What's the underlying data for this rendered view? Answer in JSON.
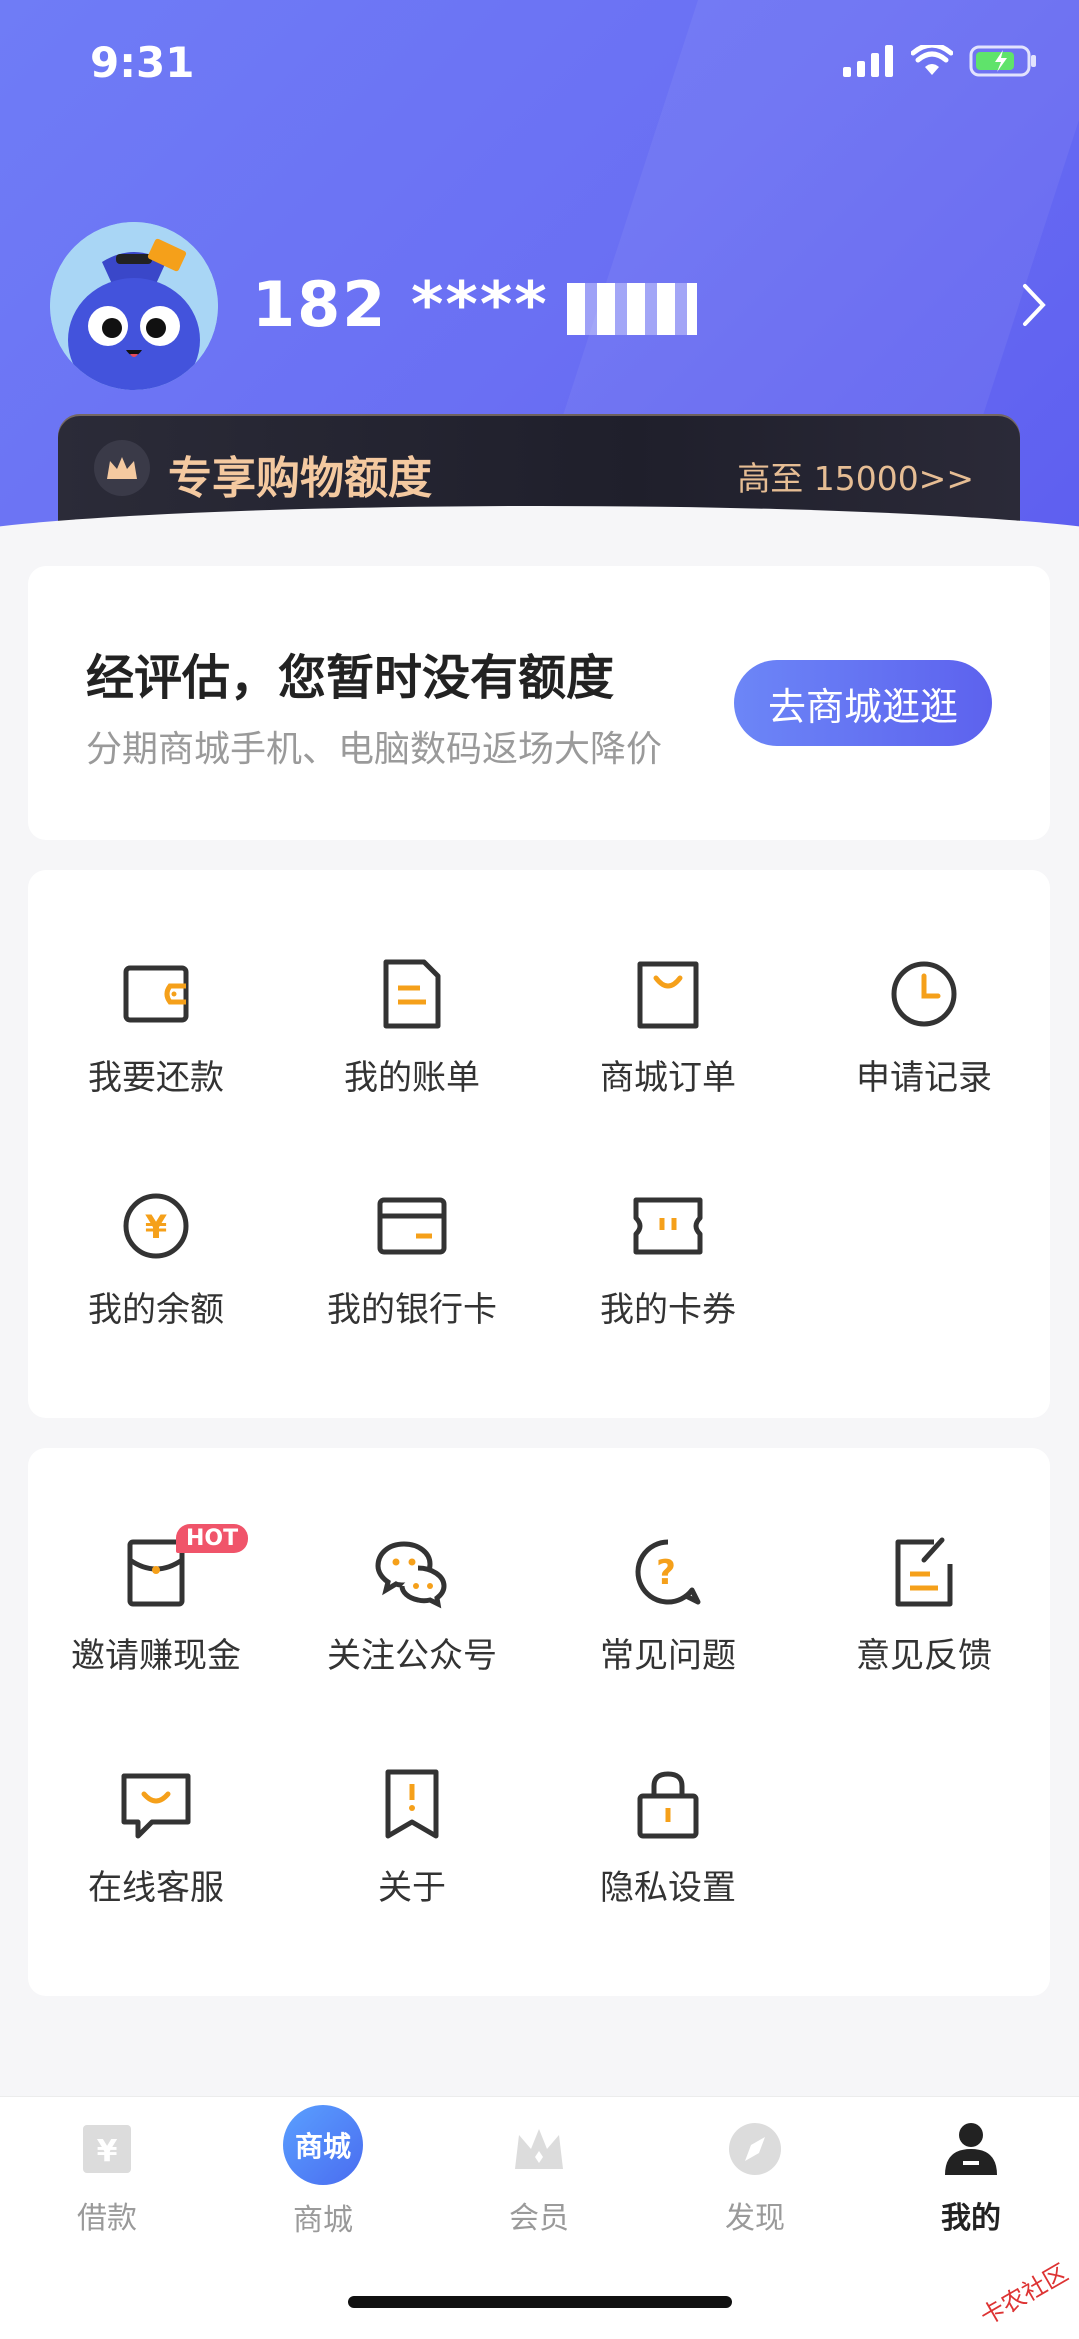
{
  "status_bar": {
    "time": "9:31"
  },
  "profile": {
    "phone": "182 ****",
    "avatar": "mascot-avatar"
  },
  "vip_banner": {
    "title": "专享购物额度",
    "limit": "高至 15000>>"
  },
  "credit_card": {
    "title": "经评估，您暂时没有额度",
    "subtitle": "分期商城手机、电脑数码返场大降价",
    "button": "去商城逛逛"
  },
  "services": [
    {
      "label": "我要还款",
      "icon": "wallet-icon"
    },
    {
      "label": "我的账单",
      "icon": "bill-icon"
    },
    {
      "label": "商城订单",
      "icon": "shopping-bag-icon"
    },
    {
      "label": "申请记录",
      "icon": "clock-icon"
    },
    {
      "label": "我的余额",
      "icon": "yuan-coin-icon"
    },
    {
      "label": "我的银行卡",
      "icon": "bank-card-icon"
    },
    {
      "label": "我的卡券",
      "icon": "coupon-icon"
    }
  ],
  "tools": [
    {
      "label": "邀请赚现金",
      "icon": "red-envelope-icon",
      "badge": "HOT"
    },
    {
      "label": "关注公众号",
      "icon": "wechat-icon"
    },
    {
      "label": "常见问题",
      "icon": "question-icon"
    },
    {
      "label": "意见反馈",
      "icon": "feedback-icon"
    },
    {
      "label": "在线客服",
      "icon": "customer-service-icon"
    },
    {
      "label": "关于",
      "icon": "about-icon"
    },
    {
      "label": "隐私设置",
      "icon": "lock-icon"
    }
  ],
  "tabbar": [
    {
      "label": "借款",
      "icon": "loan-icon"
    },
    {
      "label": "商城",
      "icon": "mall-icon",
      "icon_text": "商城"
    },
    {
      "label": "会员",
      "icon": "crown-icon"
    },
    {
      "label": "发现",
      "icon": "compass-icon"
    },
    {
      "label": "我的",
      "icon": "user-icon",
      "active": true
    }
  ],
  "watermark": "卡农社区",
  "colors": {
    "accent": "#5d62ee",
    "icon_orange": "#f5a01a",
    "icon_dark": "#333333",
    "vip_gold": "#f4c9a0"
  }
}
